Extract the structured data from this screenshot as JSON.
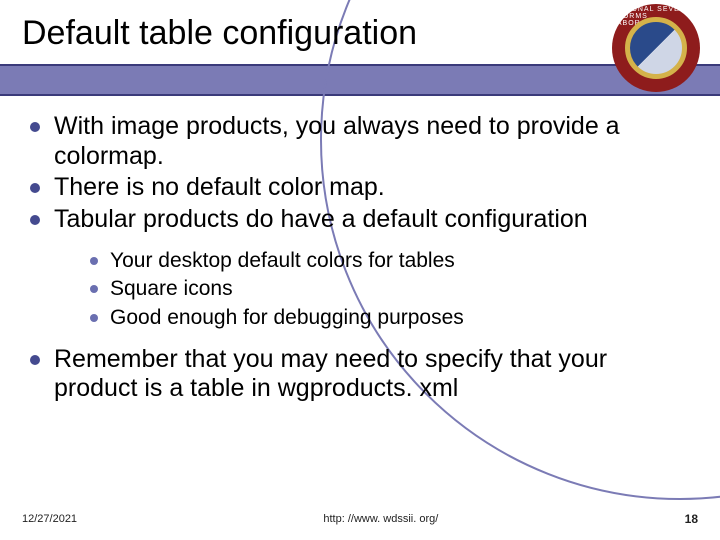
{
  "title": "Default table configuration",
  "logo": {
    "ring_text": "NATIONAL SEVERE STORMS LABORATORY"
  },
  "bullets": {
    "main": [
      "With image products, you always need to provide a colormap.",
      "There is no default color map.",
      "Tabular products do have a default configuration",
      "Remember that you may need to specify that your product is a table in wgproducts. xml"
    ],
    "sub": [
      "Your desktop default colors for tables",
      "Square icons",
      "Good enough for debugging purposes"
    ]
  },
  "footer": {
    "date": "12/27/2021",
    "url": "http: //www. wdssii. org/",
    "page": "18"
  }
}
